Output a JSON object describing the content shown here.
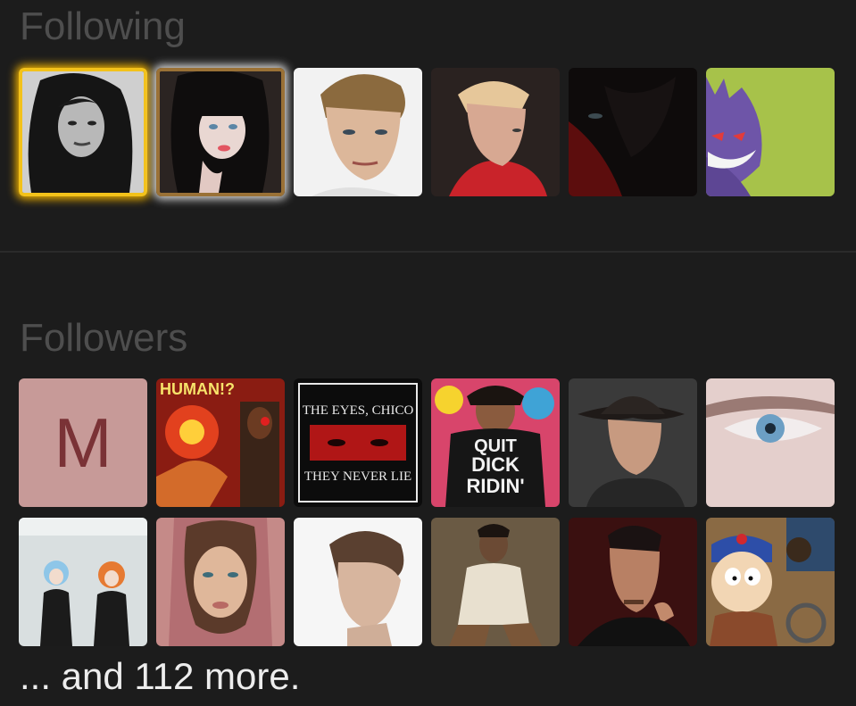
{
  "following": {
    "heading": "Following",
    "avatars": [
      {
        "name": "avatar-dark-haired-woman-bw",
        "highlight": "#f3c21a"
      },
      {
        "name": "avatar-black-haired-woman",
        "highlight": "#9a7136"
      },
      {
        "name": "avatar-3d-man-portrait",
        "highlight": ""
      },
      {
        "name": "avatar-blonde-man-red-jacket",
        "highlight": ""
      },
      {
        "name": "avatar-dark-figure",
        "highlight": ""
      },
      {
        "name": "avatar-gengar",
        "highlight": ""
      }
    ]
  },
  "followers": {
    "heading": "Followers",
    "letter_avatar": {
      "letter": "M",
      "background": "#c79a98",
      "color": "#7a3236"
    },
    "row1": [
      {
        "name": "avatar-human-comic",
        "text": "HUMAN!?"
      },
      {
        "name": "avatar-the-eyes-chico",
        "text_top": "THE EYES, CHICO",
        "text_bottom": "THEY NEVER LIE"
      },
      {
        "name": "avatar-quit-dick-ridin-shirt",
        "shirt_lines": [
          "QUIT",
          "DICK",
          "RIDIN'"
        ]
      },
      {
        "name": "avatar-cowboy-hat-man"
      },
      {
        "name": "avatar-blue-eye-closeup"
      }
    ],
    "row2": [
      {
        "name": "avatar-anime-girls"
      },
      {
        "name": "avatar-woman-hooded"
      },
      {
        "name": "avatar-young-man-profile"
      },
      {
        "name": "avatar-man-sitting"
      },
      {
        "name": "avatar-man-smoking-cigar"
      },
      {
        "name": "avatar-south-park-stan"
      }
    ],
    "more_text": "... and 112 more."
  },
  "colors": {
    "background": "#1c1c1c",
    "heading": "#4e4e4e",
    "gold_highlight": "#f3c21a",
    "bronze_highlight": "#9a7136"
  }
}
